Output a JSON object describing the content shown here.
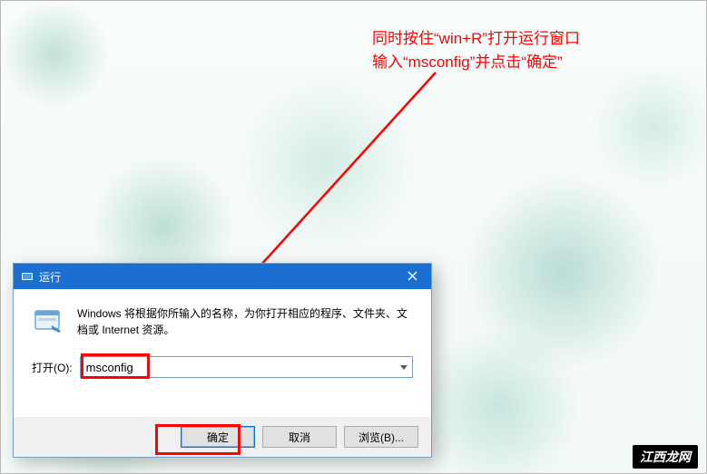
{
  "instruction": {
    "line1": "同时按住“win+R”打开运行窗口",
    "line2": "输入“msconfig”并点击“确定”"
  },
  "dialog": {
    "title": "运行",
    "description": "Windows 将根据你所输入的名称，为你打开相应的程序、文件夹、文档或 Internet 资源。",
    "open_label": "打开(O):",
    "input_value": "msconfig",
    "buttons": {
      "ok": "确定",
      "cancel": "取消",
      "browse": "浏览(B)..."
    }
  },
  "watermark": "江西龙网"
}
